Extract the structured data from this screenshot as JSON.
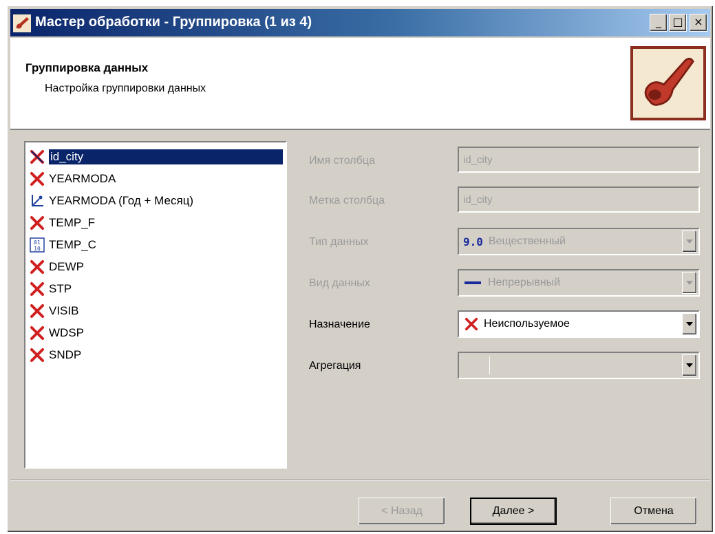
{
  "window": {
    "title": "Мастер обработки - Группировка (1 из 4)",
    "min": "_",
    "max": "□",
    "close": "×"
  },
  "header": {
    "title": "Группировка данных",
    "subtitle": "Настройка группировки данных"
  },
  "columns": [
    {
      "label": "id_city",
      "icon": "unused-x-icon",
      "selected": true
    },
    {
      "label": "YEARMODA",
      "icon": "unused-x-icon"
    },
    {
      "label": "YEARMODA (Год + Месяц)",
      "icon": "date-tree-icon"
    },
    {
      "label": "TEMP_F",
      "icon": "unused-x-icon"
    },
    {
      "label": "TEMP_C",
      "icon": "numeric-icon"
    },
    {
      "label": "DEWP",
      "icon": "unused-x-icon"
    },
    {
      "label": "STP",
      "icon": "unused-x-icon"
    },
    {
      "label": "VISIB",
      "icon": "unused-x-icon"
    },
    {
      "label": "WDSP",
      "icon": "unused-x-icon"
    },
    {
      "label": "SNDP",
      "icon": "unused-x-icon"
    }
  ],
  "form": {
    "name_label": "Имя столбца",
    "name_value": "id_city",
    "caption_label": "Метка столбца",
    "caption_value": "id_city",
    "type_label": "Тип данных",
    "type_badge": "9.0",
    "type_value": "Вещественный",
    "kind_label": "Вид данных",
    "kind_value": "Непрерывный",
    "purpose_label": "Назначение",
    "purpose_value": "Неиспользуемое",
    "aggregation_label": "Агрегация",
    "aggregation_value": ""
  },
  "buttons": {
    "back": "< Назад",
    "next": "Далее >",
    "cancel": "Отмена"
  },
  "colors": {
    "title_bar": "#0a246a",
    "selection": "#0a246a",
    "unused_x": "#d02020",
    "logo_border": "#8b2e1e"
  }
}
